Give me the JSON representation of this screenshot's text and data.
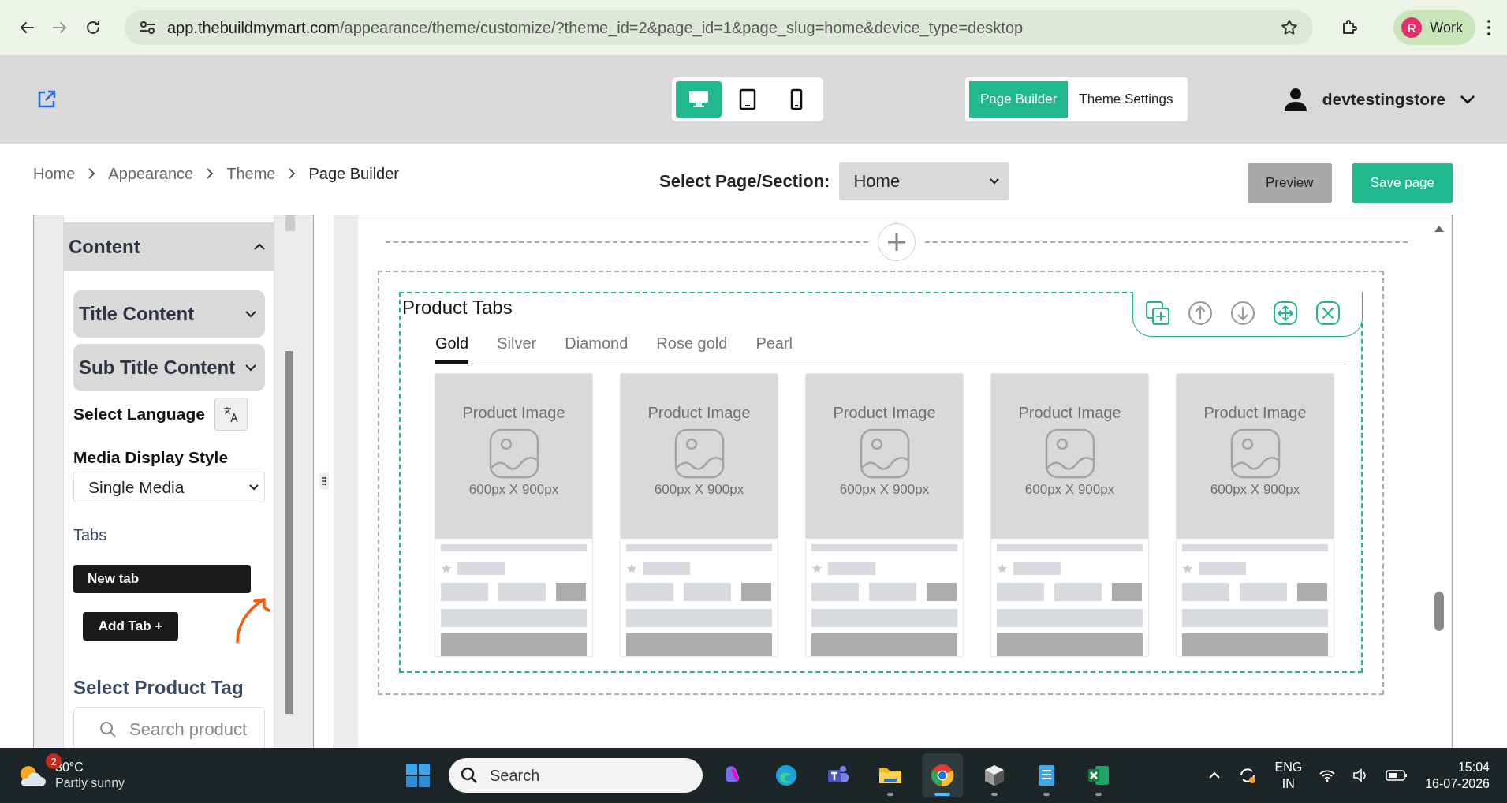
{
  "browser": {
    "url_host": "app.thebuildmymart.com",
    "url_path": "/appearance/theme/customize/?theme_id=2&page_id=1&page_slug=home&device_type=desktop",
    "profile_initial": "R",
    "profile_label": "Work"
  },
  "header": {
    "devices": [
      {
        "kind": "desktop",
        "selected": true
      },
      {
        "kind": "tablet",
        "selected": false
      },
      {
        "kind": "mobile",
        "selected": false
      }
    ],
    "modes": [
      {
        "label": "Page Builder",
        "selected": true
      },
      {
        "label": "Theme Settings",
        "selected": false
      }
    ],
    "store_name": "devtestingstore"
  },
  "breadcrumb": [
    "Home",
    "Appearance",
    "Theme",
    "Page Builder"
  ],
  "page_select": {
    "label": "Select Page/Section:",
    "value": "Home"
  },
  "actions": [
    {
      "label": "Preview",
      "kind": "secondary"
    },
    {
      "label": "Save page",
      "kind": "primary"
    }
  ],
  "sidebar": {
    "section": {
      "title": "Content",
      "expanded": true
    },
    "accordions": [
      {
        "title": "Title Content",
        "expanded": false
      },
      {
        "title": "Sub Title Content",
        "expanded": false
      }
    ],
    "language_label": "Select Language",
    "media_label": "Media Display Style",
    "media_value": "Single Media",
    "tabs_label": "Tabs",
    "tab_names": [
      "New tab"
    ],
    "add_tab": "Add Tab +",
    "tag_label": "Select Product Tag",
    "search_placeholder": "Search product"
  },
  "section": {
    "title": "Product Tabs",
    "tabs": [
      {
        "label": "Gold",
        "selected": true
      },
      {
        "label": "Silver",
        "selected": false
      },
      {
        "label": "Diamond",
        "selected": false
      },
      {
        "label": "Rose gold",
        "selected": false
      },
      {
        "label": "Pearl",
        "selected": false
      }
    ],
    "products": [
      {
        "image_label": "Product Image",
        "size": "600px X 900px"
      },
      {
        "image_label": "Product Image",
        "size": "600px X 900px"
      },
      {
        "image_label": "Product Image",
        "size": "600px X 900px"
      },
      {
        "image_label": "Product Image",
        "size": "600px X 900px"
      },
      {
        "image_label": "Product Image",
        "size": "600px X 900px"
      }
    ]
  },
  "taskbar": {
    "weather_badge": "2",
    "temperature": "30°C",
    "weather": "Partly sunny",
    "search_placeholder": "Search",
    "apps": [
      {
        "kind": "copilot",
        "selected": false,
        "running": false
      },
      {
        "kind": "edge",
        "selected": false,
        "running": false
      },
      {
        "kind": "teams",
        "selected": false,
        "running": false
      },
      {
        "kind": "folder",
        "selected": false,
        "running": true
      },
      {
        "kind": "chrome",
        "selected": true,
        "running": true
      },
      {
        "kind": "cube",
        "selected": false,
        "running": true
      },
      {
        "kind": "notepad",
        "selected": false,
        "running": true
      },
      {
        "kind": "excel",
        "selected": false,
        "running": true
      }
    ],
    "language": "ENG",
    "region": "IN",
    "time": "15:04",
    "date": "16-07-2026"
  }
}
